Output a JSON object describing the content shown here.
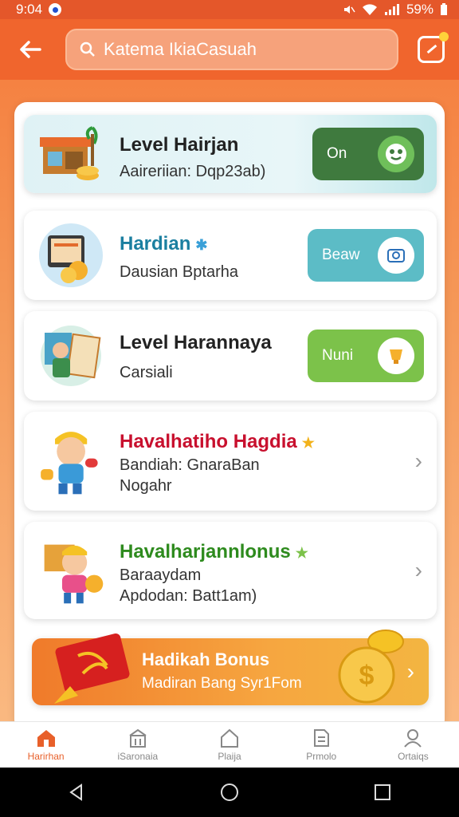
{
  "status": {
    "time": "9:04",
    "battery": "59%"
  },
  "header": {
    "search_text": "Katema IkiaCasuah"
  },
  "cards": [
    {
      "title": "Level Hairjan",
      "subtitle": "Aaireriian: Dqp23ab)",
      "toggle_label": "On"
    },
    {
      "title": "Hardian",
      "subtitle": "Dausian Bptarha",
      "toggle_label": "Beaw"
    },
    {
      "title": "Level Harannaya",
      "subtitle": "Carsiali",
      "toggle_label": "Nuni"
    },
    {
      "title": "Havalhatiho Hagdia",
      "subtitle": "Bandiah: GnaraBan",
      "subtitle2": "Nogahr"
    },
    {
      "title": "Havalharjannlonus",
      "subtitle": "Baraaydam",
      "subtitle2": "Apdodan: Batt1am)"
    }
  ],
  "bonus": {
    "title": "Hadikah Bonus",
    "subtitle": "Madiran Bang Syr1Fom"
  },
  "tabs": [
    {
      "label": "Harirhan",
      "icon": "home-icon"
    },
    {
      "label": "iSaronaia",
      "icon": "store-icon"
    },
    {
      "label": "Plaija",
      "icon": "house-icon"
    },
    {
      "label": "Prmolo",
      "icon": "document-icon"
    },
    {
      "label": "Ortaiqs",
      "icon": "person-icon"
    }
  ],
  "colors": {
    "primary": "#f0652d",
    "title_red": "#c8102e",
    "title_green": "#2e8b1e",
    "title_teal": "#1b7fa0",
    "toggle_green": "#3f7a3e",
    "toggle_teal": "#5cbcc6",
    "toggle_lime": "#7cc24a"
  }
}
